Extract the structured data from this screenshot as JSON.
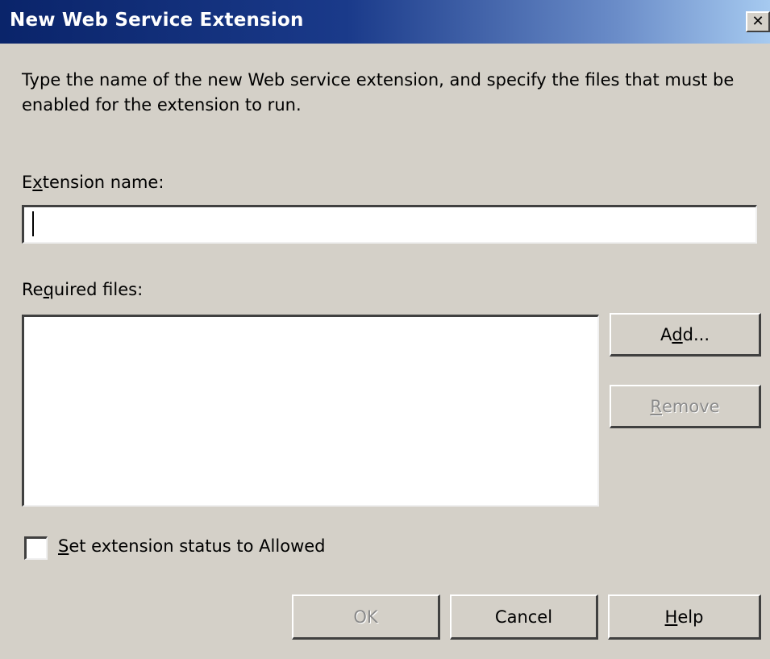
{
  "window": {
    "title": "New Web Service Extension",
    "close_glyph": "✕"
  },
  "instructions": "Type the name of the new Web service extension, and specify the files that must be enabled for the extension to run.",
  "extension_name": {
    "label_pre": "E",
    "label_accel": "x",
    "label_post": "tension name:",
    "value": ""
  },
  "required_files": {
    "label_pre": "Re",
    "label_accel": "q",
    "label_post": "uired files:",
    "items": []
  },
  "buttons": {
    "add_pre": "A",
    "add_accel": "d",
    "add_post": "d...",
    "remove_pre": "",
    "remove_accel": "R",
    "remove_post": "emove",
    "ok": "OK",
    "cancel": "Cancel",
    "help_pre": "",
    "help_accel": "H",
    "help_post": "elp"
  },
  "status_checkbox": {
    "label_pre": "",
    "label_accel": "S",
    "label_post": "et extension status to Allowed",
    "checked": false
  },
  "colors": {
    "dialog_bg": "#d4d0c8",
    "titlebar_start": "#0a246a",
    "titlebar_end": "#a6caf0",
    "disabled_text": "#8a8a8a"
  },
  "icons": {
    "close": "close-icon"
  }
}
